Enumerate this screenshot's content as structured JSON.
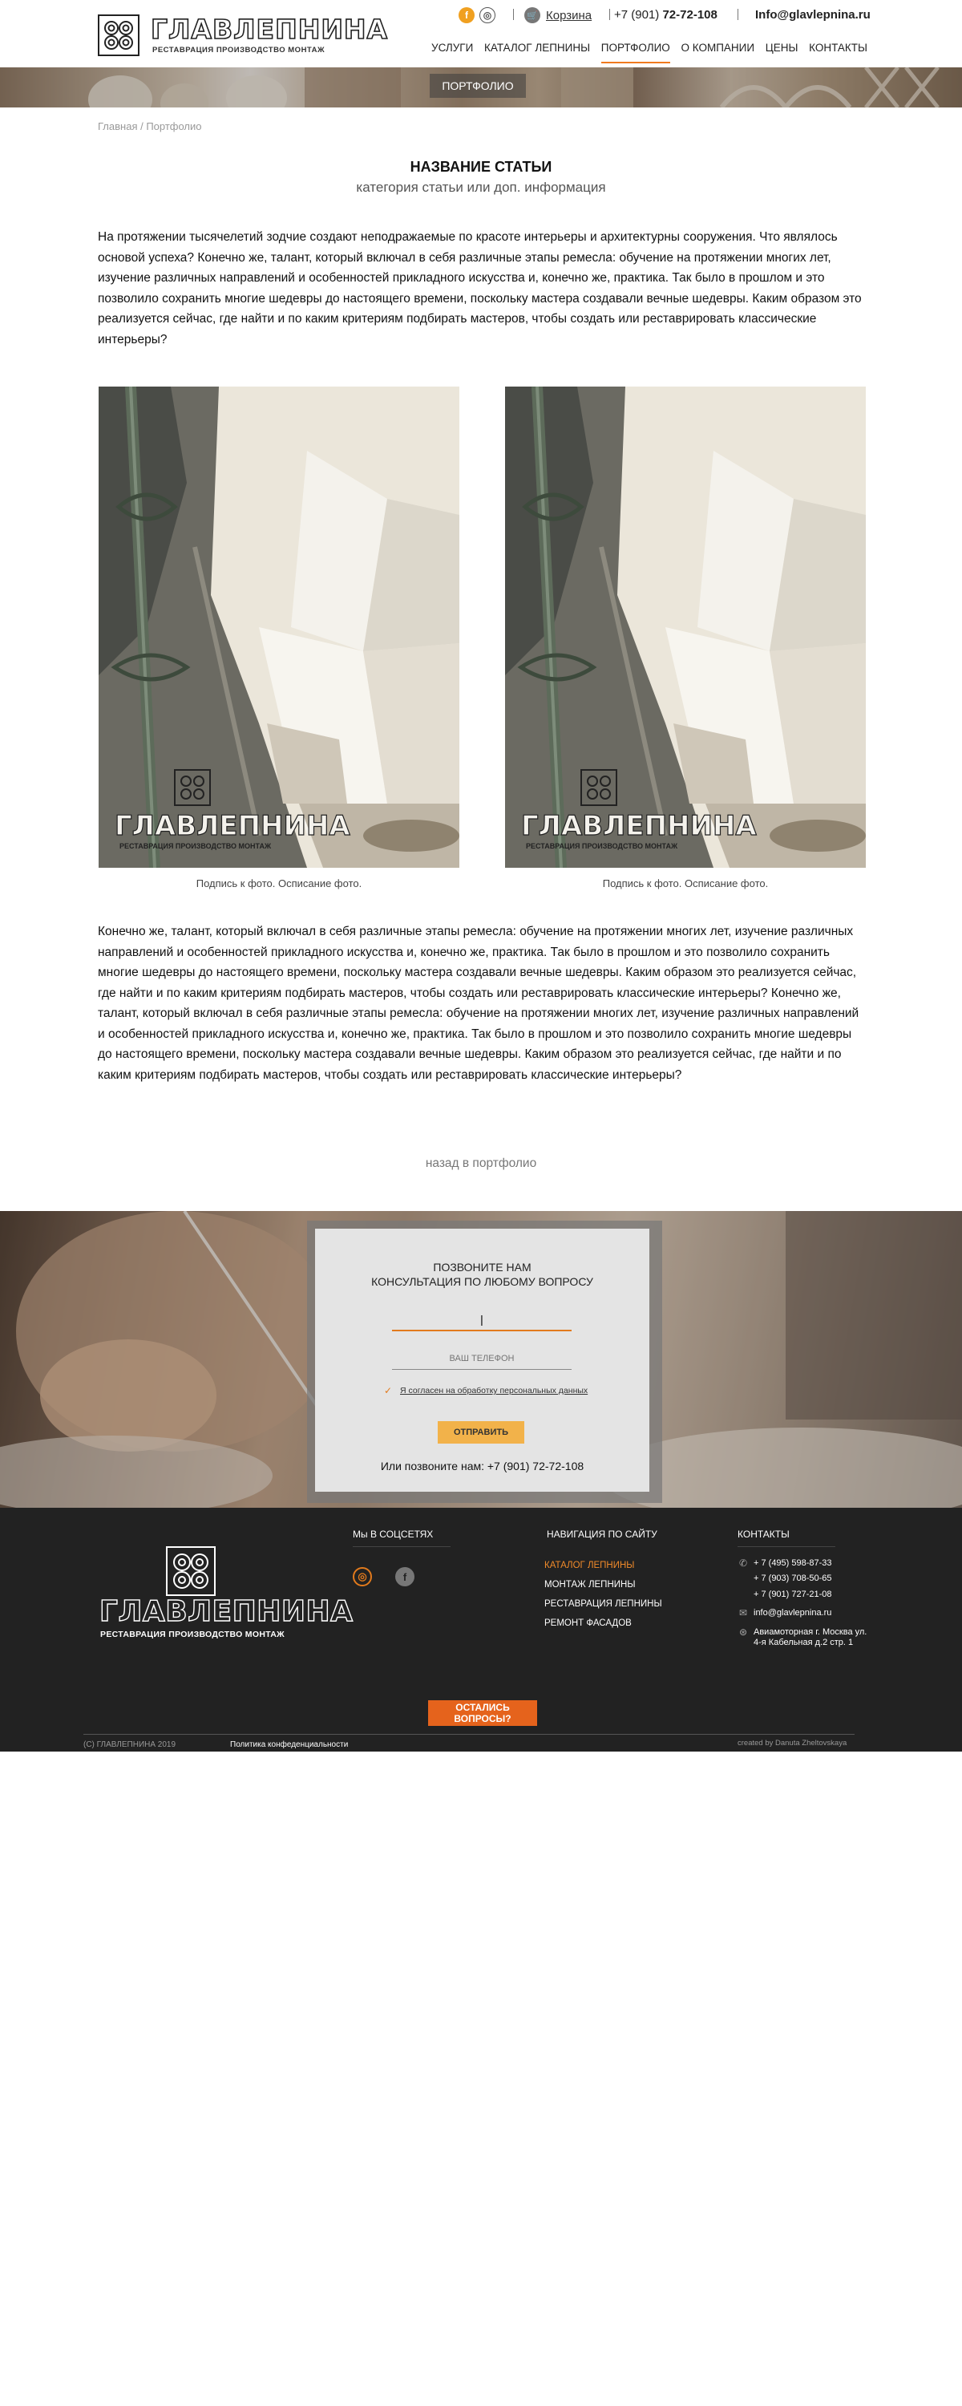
{
  "header": {
    "logo_word": "ГЛАВЛЕПНИНА",
    "logo_tagline": "РЕСТАВРАЦИЯ ПРОИЗВОДСТВО МОНТАЖ",
    "cart_label": "Корзина",
    "phone_prefix": "+7 (901) ",
    "phone_main": "72-72-108",
    "email": "Info@glavlepnina.ru",
    "nav": [
      {
        "label": "УСЛУГИ",
        "active": false
      },
      {
        "label": "КАТАЛОГ ЛЕПНИНЫ",
        "active": false
      },
      {
        "label": "ПОРТФОЛИО",
        "active": true
      },
      {
        "label": "О КОМПАНИИ",
        "active": false
      },
      {
        "label": "ЦЕНЫ",
        "active": false
      },
      {
        "label": "КОНТАКТЫ",
        "active": false
      }
    ]
  },
  "banner": {
    "label": "ПОРТФОЛИО"
  },
  "breadcrumb": "Главная / Портфолио",
  "article": {
    "title": "НАЗВАНИЕ СТАТЬИ",
    "subtitle": "категория статьи или доп. информация",
    "intro": "На протяжении тысячелетий зодчие создают неподражаемые по красоте интерьеры и архитектурны сооружения. Что являлось основой успеха? Конечно же, талант, который включал в себя различные этапы ремесла: обучение на протяжении многих лет, изучение различных направлений и особенностей прикладного искусства и, конечно же, практика. Так было в прошлом и это позволило сохранить многие шедевры до настоящего времени, поскольку мастера создавали вечные шедевры. Каким образом это реализуется сейчас, где найти и по каким критериям подбирать мастеров, чтобы создать или реставрировать классические интерьеры?",
    "photos": [
      {
        "caption": "Подпись к фото. Осписание фото.",
        "watermark_word": "ГЛАВЛЕПНИНА",
        "watermark_tag": "РЕСТАВРАЦИЯ ПРОИЗВОДСТВО МОНТАЖ"
      },
      {
        "caption": "Подпись к фото. Осписание фото.",
        "watermark_word": "ГЛАВЛЕПНИНА",
        "watermark_tag": "РЕСТАВРАЦИЯ ПРОИЗВОДСТВО МОНТАЖ"
      }
    ],
    "body": "Конечно же, талант, который включал в себя различные этапы ремесла: обучение на протяжении многих лет, изучение различных направлений и особенностей прикладного искусства и, конечно же, практика. Так было в прошлом и это позволило сохранить многие шедевры до настоящего времени, поскольку мастера создавали вечные шедевры. Каким образом это реализуется сейчас, где найти и по каким критериям подбирать мастеров, чтобы создать или реставрировать классические интерьеры?  Конечно же, талант, который включал в себя различные этапы ремесла: обучение на протяжении многих лет, изучение различных направлений и особенностей прикладного искусства и, конечно же, практика. Так было в прошлом и это позволило сохранить многие шедевры до настоящего времени, поскольку мастера создавали вечные шедевры. Каким образом это реализуется сейчас, где найти и по каким критериям подбирать мастеров, чтобы создать или реставрировать классические интерьеры?",
    "back_link": "назад в портфолио"
  },
  "callback": {
    "title_line1": "ПОЗВОНИТЕ НАМ",
    "title_line2": "КОНСУЛЬТАЦИЯ ПО ЛЮБОМУ ВОПРОСУ",
    "name_value": "|",
    "phone_placeholder": "ВАШ ТЕЛЕФОН",
    "agree_text": "Я согласен на обработку персональных данных",
    "submit_label": "ОТПРАВИТЬ",
    "call_text": "Или позвоните нам: +7 (901) 72-72-108"
  },
  "footer": {
    "logo_word": "ГЛАВЛЕПНИНА",
    "logo_tagline": "РЕСТАВРАЦИЯ ПРОИЗВОДСТВО МОНТАЖ",
    "social_heading": "Мы В СОЦСЕТЯХ",
    "nav_heading": "НАВИГАЦИЯ ПО САЙТУ",
    "nav": [
      {
        "label": "КАТАЛОГ ЛЕПНИНЫ",
        "active": true
      },
      {
        "label": "МОНТАЖ ЛЕПНИНЫ",
        "active": false
      },
      {
        "label": "РЕСТАВРАЦИЯ ЛЕПНИНЫ",
        "active": false
      },
      {
        "label": "РЕМОНТ ФАСАДОВ",
        "active": false
      }
    ],
    "contacts_heading": "КОНТАКТЫ",
    "phones": [
      "+ 7 (495) 598-87-33",
      "+ 7 (903) 708-50-65",
      "+ 7 (901) 727-21-08"
    ],
    "email": "info@glavlepnina.ru",
    "address_line1": "Авиамоторная г. Москва ул.",
    "address_line2": "4-я Кабельная д.2 стр. 1",
    "ask_button": "ОСТАЛИСЬ ВОПРОСЫ?",
    "copyright": "(С) ГЛАВЛЕПНИНА 2019",
    "policy": "Политика конфеденциальности",
    "created_by": "created by Danuta Zheltovskaya"
  },
  "colors": {
    "accent": "#f07a1e",
    "footer_bg": "#222222",
    "button_yellow": "#f2b24a",
    "button_orange": "#e5631c"
  }
}
